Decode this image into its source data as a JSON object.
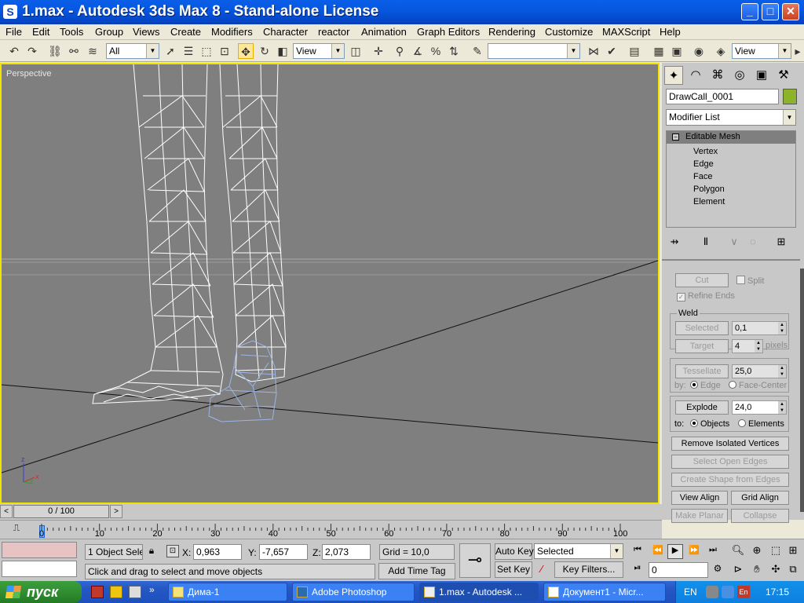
{
  "window": {
    "title": "1.max - Autodesk 3ds Max 8  - Stand-alone License",
    "minimize": "_",
    "maximize": "□",
    "close": "✕"
  },
  "menu": [
    "File",
    "Edit",
    "Tools",
    "Group",
    "Views",
    "Create",
    "Modifiers",
    "Character",
    "reactor",
    "Animation",
    "Graph Editors",
    "Rendering",
    "Customize",
    "MAXScript",
    "Help"
  ],
  "toolbar": {
    "filter_value": "All",
    "ref_coord_value": "View",
    "named_sel_value": "",
    "view_combo_value": "View"
  },
  "viewport": {
    "label": "Perspective"
  },
  "command_panel": {
    "object_name": "DrawCall_0001",
    "object_color": "#8db32a",
    "modifier_list": "Modifier List",
    "stack_root": "Editable Mesh",
    "stack_items": [
      "Vertex",
      "Edge",
      "Face",
      "Polygon",
      "Element"
    ],
    "cut_label": "Cut",
    "split_label": "Split",
    "refine_ends_label": "Refine Ends",
    "weld_group": "Weld",
    "selected_label": "Selected",
    "selected_value": "0,1",
    "target_label": "Target",
    "target_value": "4",
    "pixels_label": "pixels",
    "tessellate_label": "Tessellate",
    "tessellate_value": "25,0",
    "by_label": "by:",
    "edge_label": "Edge",
    "face_center_label": "Face-Center",
    "explode_label": "Explode",
    "explode_value": "24,0",
    "to_label": "to:",
    "objects_label": "Objects",
    "elements_label": "Elements",
    "remove_isolated_label": "Remove Isolated Vertices",
    "select_open_edges_label": "Select Open Edges",
    "create_shape_label": "Create Shape from Edges",
    "view_align_label": "View Align",
    "grid_align_label": "Grid Align",
    "make_planar_label": "Make Planar",
    "collapse_label": "Collapse"
  },
  "timeline": {
    "frame_display": "0 / 100",
    "ticks": [
      "0",
      "10",
      "20",
      "30",
      "40",
      "50",
      "60",
      "70",
      "80",
      "90",
      "100"
    ]
  },
  "status": {
    "selection_info": "1 Object Sele",
    "x_label": "X:",
    "x_value": "0,963",
    "y_label": "Y:",
    "y_value": "-7,657",
    "z_label": "Z:",
    "z_value": "2,073",
    "grid": "Grid = 10,0",
    "prompt": "Click and drag to select and move objects",
    "add_time_tag": "Add Time Tag",
    "auto_key": "Auto Key",
    "set_key": "Set Key",
    "key_mode_value": "Selected",
    "key_filters": "Key Filters...",
    "current_frame": "0"
  },
  "taskbar": {
    "start_label": "пуск",
    "tasks": [
      {
        "label": "Дима-1",
        "active": false
      },
      {
        "label": "Adobe Photoshop",
        "active": false
      },
      {
        "label": "1.max - Autodesk ...",
        "active": true
      },
      {
        "label": "Документ1 - Micr...",
        "active": false
      }
    ],
    "language": "EN",
    "clock": "17:15"
  }
}
